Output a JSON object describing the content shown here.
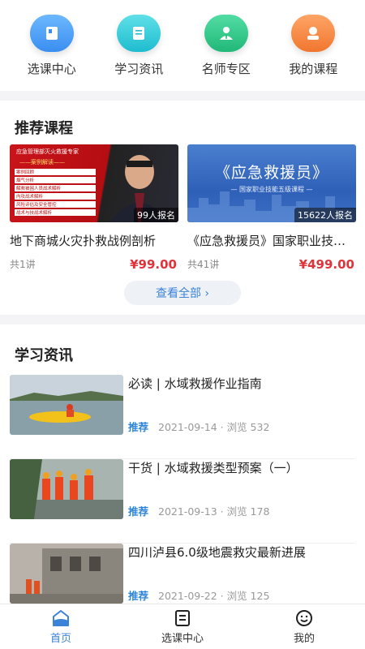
{
  "nav": {
    "items": [
      {
        "label": "选课中心",
        "icon": "course-center-icon",
        "color": "#4a9ff2"
      },
      {
        "label": "学习资讯",
        "icon": "study-news-icon",
        "color": "#2ec8d8"
      },
      {
        "label": "名师专区",
        "icon": "teacher-icon",
        "color": "#2fc78b"
      },
      {
        "label": "我的课程",
        "icon": "my-courses-icon",
        "color": "#f58a4a"
      }
    ]
  },
  "courses": {
    "title": "推荐课程",
    "items": [
      {
        "title": "地下商城火灾扑救战例剖析",
        "enrolled": "99人报名",
        "lessons": "共1讲",
        "price": "¥99.00",
        "thumb_heading": "应急管理部灭火救援专家",
        "thumb_sub": "——案例解读——",
        "thumb_lines": [
          "案例回顾",
          "烟气分析",
          "解救被困人员战术解析",
          "内攻战术解析",
          "风险评估及安全管控",
          "战术与技战术解析"
        ]
      },
      {
        "title": "《应急救援员》国家职业技能五级课程",
        "enrolled": "15622人报名",
        "lessons": "共41讲",
        "price": "¥499.00",
        "thumb_heading": "《应急救援员》",
        "thumb_sub": "— 国家职业技能五级课程 —"
      }
    ],
    "view_all": "查看全部 ›"
  },
  "news": {
    "title": "学习资讯",
    "items": [
      {
        "title": "必读 | 水域救援作业指南",
        "tag": "推荐",
        "date": "2021-09-14",
        "views": "· 浏览 532"
      },
      {
        "title": "干货 | 水域救援类型预案（一）",
        "tag": "推荐",
        "date": "2021-09-13",
        "views": "· 浏览 178"
      },
      {
        "title": "四川泸县6.0级地震救灾最新进展",
        "tag": "推荐",
        "date": "2021-09-22",
        "views": "· 浏览 125"
      }
    ]
  },
  "tabbar": {
    "items": [
      {
        "label": "首页",
        "icon": "home-icon"
      },
      {
        "label": "选课中心",
        "icon": "course-center-icon"
      },
      {
        "label": "我的",
        "icon": "profile-icon"
      }
    ],
    "active_color": "#3b82d9"
  }
}
